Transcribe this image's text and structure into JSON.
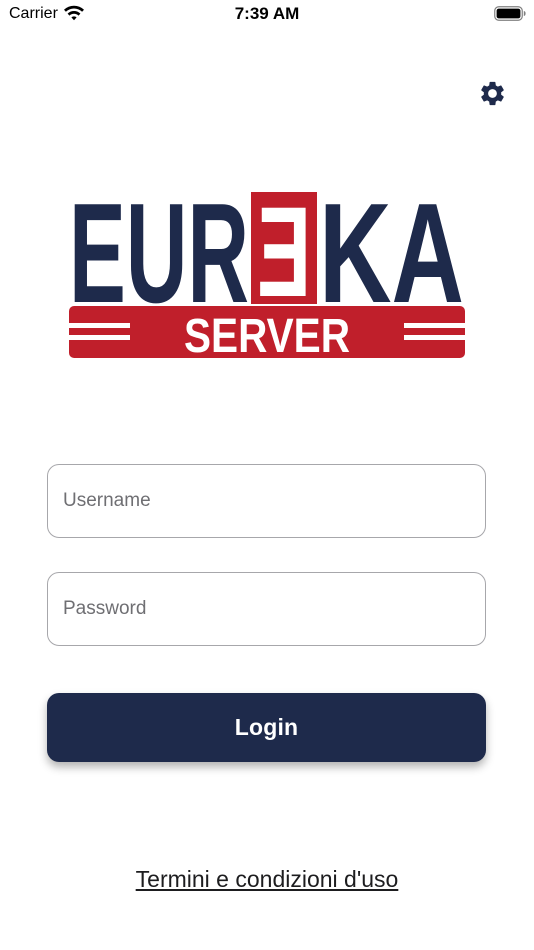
{
  "status_bar": {
    "carrier": "Carrier",
    "time": "7:39 AM",
    "icons": [
      "wifi-icon",
      "battery-icon"
    ]
  },
  "settings": {
    "icon": "gear-icon"
  },
  "logo": {
    "line1_left": "EUR",
    "line1_mid": "E",
    "line1_right": "KA",
    "line2": "SERVER",
    "colors": {
      "navy": "#1e2a4b",
      "red": "#c01f2b"
    }
  },
  "form": {
    "username_placeholder": "Username",
    "username_value": "",
    "password_placeholder": "Password",
    "password_value": "",
    "login_label": "Login"
  },
  "footer": {
    "terms_label": "Termini e condizioni d'uso"
  },
  "colors": {
    "primary": "#1e2a4b",
    "field_border": "#a7a7ab",
    "placeholder": "#6f6f73"
  }
}
